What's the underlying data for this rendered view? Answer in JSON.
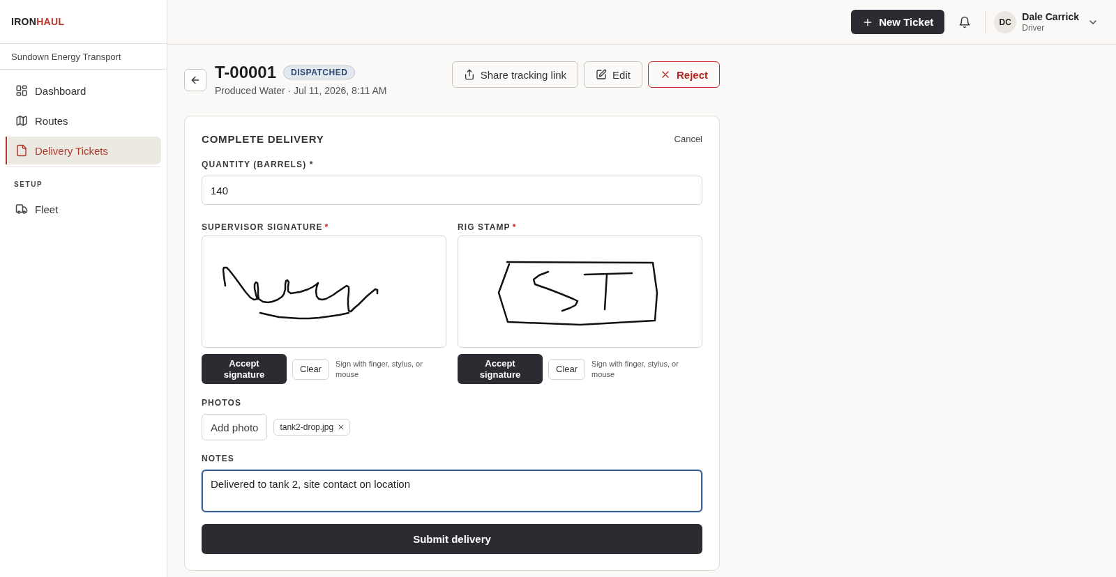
{
  "sidebar": {
    "logo": {
      "part_1": "IRON",
      "part_2": "HAUL"
    },
    "organization": "Sundown Energy Transport",
    "nav_groups": [
      {
        "items": [
          {
            "label": "Dashboard",
            "selected": false
          },
          {
            "label": "Routes",
            "selected": false
          },
          {
            "label": "Delivery Tickets",
            "selected": true
          }
        ]
      },
      {
        "heading": "SETUP",
        "items": [
          {
            "label": "Fleet",
            "selected": false
          }
        ]
      }
    ]
  },
  "topbar": {
    "new_ticket_button": "New Ticket",
    "user": {
      "initials": "DC",
      "name": "Dale Carrick",
      "role": "Driver"
    }
  },
  "ticket": {
    "id": "T-00001",
    "status": "DISPATCHED",
    "subtitle": "Produced Water · Jul 11, 2026, 8:11 AM",
    "actions": [
      {
        "label": "Share tracking link",
        "kind": "share"
      },
      {
        "label": "Edit",
        "kind": "edit"
      },
      {
        "label": "Reject",
        "kind": "reject"
      }
    ]
  },
  "form": {
    "title": "COMPLETE DELIVERY",
    "cancel": "Cancel",
    "quantity": {
      "label": "QUANTITY (BARRELS) *",
      "value": "140"
    },
    "signatures": [
      {
        "kind": "signature",
        "label": "SUPERVISOR SIGNATURE",
        "required_mark": "*",
        "accept_button": "Accept signature",
        "clear_button": "Clear",
        "hint": "Sign with finger, stylus, or mouse"
      },
      {
        "kind": "stamp",
        "label": "RIG STAMP",
        "required_mark": "*",
        "accept_button": "Accept signature",
        "clear_button": "Clear",
        "hint": "Sign with finger, stylus, or mouse"
      }
    ],
    "photos": {
      "label": "PHOTOS",
      "add_button": "Add photo",
      "files": [
        {
          "name": "tank2-drop.jpg"
        }
      ]
    },
    "notes": {
      "label": "NOTES",
      "value": "Delivered to tank 2, site contact on location",
      "focused": true
    },
    "submit_button": "Submit delivery"
  }
}
